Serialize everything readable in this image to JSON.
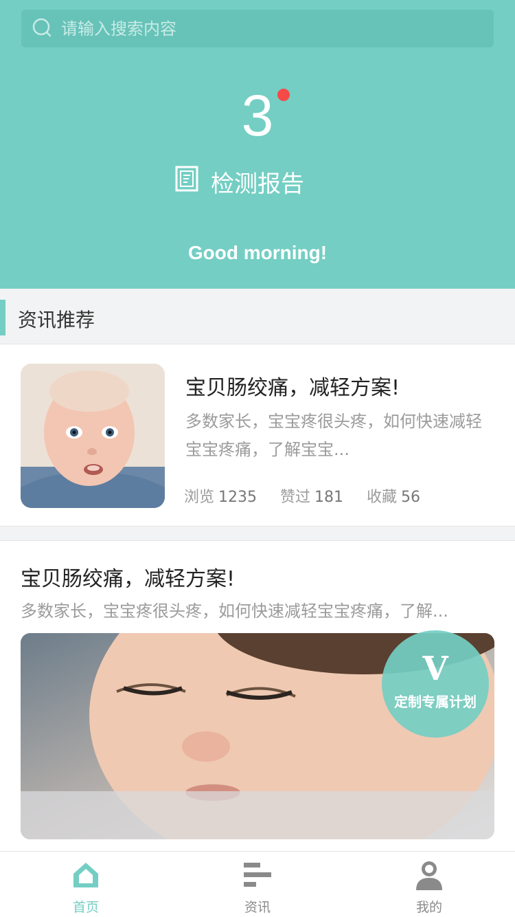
{
  "search": {
    "placeholder": "请输入搜索内容"
  },
  "header": {
    "count": "3",
    "report_label": "检测报告",
    "greeting": "Good morning!"
  },
  "section": {
    "title": "资讯推荐"
  },
  "card1": {
    "title": "宝贝肠绞痛，减轻方案!",
    "desc": "多数家长，宝宝疼很头疼，如何快速减轻宝宝疼痛，了解宝宝...",
    "stats": [
      {
        "label": "浏览",
        "value": "1235"
      },
      {
        "label": "赞过",
        "value": "181"
      },
      {
        "label": "收藏",
        "value": "56"
      }
    ]
  },
  "card2": {
    "title": "宝贝肠绞痛，减轻方案!",
    "desc": "多数家长，宝宝疼很头疼，如何快速减轻宝宝疼痛，了解...",
    "badge_icon": "V",
    "badge_label": "定制专属计划"
  },
  "tabs": [
    {
      "label": "首页",
      "icon": "home-icon",
      "active": true
    },
    {
      "label": "资讯",
      "icon": "news-icon",
      "active": false
    },
    {
      "label": "我的",
      "icon": "user-icon",
      "active": false
    }
  ],
  "colors": {
    "accent": "#74cec3",
    "dot": "#f54a48"
  }
}
